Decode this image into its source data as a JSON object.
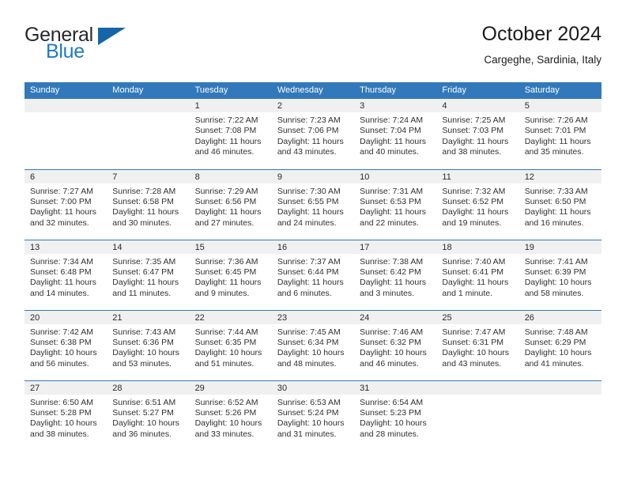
{
  "brand": {
    "name_part1": "General",
    "name_part2": "Blue",
    "flag_icon": "triangle-flag-icon",
    "accent_color": "#1e7bc4",
    "flag_color": "#1565a8"
  },
  "header": {
    "title": "October 2024",
    "subtitle": "Cargeghe, Sardinia, Italy"
  },
  "theme": {
    "header_bg": "#3279bb",
    "daynum_band_bg": "#f0f0f0",
    "row_separator": "#3279bb",
    "text": "#303030"
  },
  "weekday_headers": [
    "Sunday",
    "Monday",
    "Tuesday",
    "Wednesday",
    "Thursday",
    "Friday",
    "Saturday"
  ],
  "weeks": [
    [
      {
        "day": "",
        "sunrise": "",
        "sunset": "",
        "daylight_line1": "",
        "daylight_line2": "",
        "empty": true
      },
      {
        "day": "",
        "sunrise": "",
        "sunset": "",
        "daylight_line1": "",
        "daylight_line2": "",
        "empty": true
      },
      {
        "day": "1",
        "sunrise": "Sunrise: 7:22 AM",
        "sunset": "Sunset: 7:08 PM",
        "daylight_line1": "Daylight: 11 hours",
        "daylight_line2": "and 46 minutes."
      },
      {
        "day": "2",
        "sunrise": "Sunrise: 7:23 AM",
        "sunset": "Sunset: 7:06 PM",
        "daylight_line1": "Daylight: 11 hours",
        "daylight_line2": "and 43 minutes."
      },
      {
        "day": "3",
        "sunrise": "Sunrise: 7:24 AM",
        "sunset": "Sunset: 7:04 PM",
        "daylight_line1": "Daylight: 11 hours",
        "daylight_line2": "and 40 minutes."
      },
      {
        "day": "4",
        "sunrise": "Sunrise: 7:25 AM",
        "sunset": "Sunset: 7:03 PM",
        "daylight_line1": "Daylight: 11 hours",
        "daylight_line2": "and 38 minutes."
      },
      {
        "day": "5",
        "sunrise": "Sunrise: 7:26 AM",
        "sunset": "Sunset: 7:01 PM",
        "daylight_line1": "Daylight: 11 hours",
        "daylight_line2": "and 35 minutes."
      }
    ],
    [
      {
        "day": "6",
        "sunrise": "Sunrise: 7:27 AM",
        "sunset": "Sunset: 7:00 PM",
        "daylight_line1": "Daylight: 11 hours",
        "daylight_line2": "and 32 minutes."
      },
      {
        "day": "7",
        "sunrise": "Sunrise: 7:28 AM",
        "sunset": "Sunset: 6:58 PM",
        "daylight_line1": "Daylight: 11 hours",
        "daylight_line2": "and 30 minutes."
      },
      {
        "day": "8",
        "sunrise": "Sunrise: 7:29 AM",
        "sunset": "Sunset: 6:56 PM",
        "daylight_line1": "Daylight: 11 hours",
        "daylight_line2": "and 27 minutes."
      },
      {
        "day": "9",
        "sunrise": "Sunrise: 7:30 AM",
        "sunset": "Sunset: 6:55 PM",
        "daylight_line1": "Daylight: 11 hours",
        "daylight_line2": "and 24 minutes."
      },
      {
        "day": "10",
        "sunrise": "Sunrise: 7:31 AM",
        "sunset": "Sunset: 6:53 PM",
        "daylight_line1": "Daylight: 11 hours",
        "daylight_line2": "and 22 minutes."
      },
      {
        "day": "11",
        "sunrise": "Sunrise: 7:32 AM",
        "sunset": "Sunset: 6:52 PM",
        "daylight_line1": "Daylight: 11 hours",
        "daylight_line2": "and 19 minutes."
      },
      {
        "day": "12",
        "sunrise": "Sunrise: 7:33 AM",
        "sunset": "Sunset: 6:50 PM",
        "daylight_line1": "Daylight: 11 hours",
        "daylight_line2": "and 16 minutes."
      }
    ],
    [
      {
        "day": "13",
        "sunrise": "Sunrise: 7:34 AM",
        "sunset": "Sunset: 6:48 PM",
        "daylight_line1": "Daylight: 11 hours",
        "daylight_line2": "and 14 minutes."
      },
      {
        "day": "14",
        "sunrise": "Sunrise: 7:35 AM",
        "sunset": "Sunset: 6:47 PM",
        "daylight_line1": "Daylight: 11 hours",
        "daylight_line2": "and 11 minutes."
      },
      {
        "day": "15",
        "sunrise": "Sunrise: 7:36 AM",
        "sunset": "Sunset: 6:45 PM",
        "daylight_line1": "Daylight: 11 hours",
        "daylight_line2": "and 9 minutes."
      },
      {
        "day": "16",
        "sunrise": "Sunrise: 7:37 AM",
        "sunset": "Sunset: 6:44 PM",
        "daylight_line1": "Daylight: 11 hours",
        "daylight_line2": "and 6 minutes."
      },
      {
        "day": "17",
        "sunrise": "Sunrise: 7:38 AM",
        "sunset": "Sunset: 6:42 PM",
        "daylight_line1": "Daylight: 11 hours",
        "daylight_line2": "and 3 minutes."
      },
      {
        "day": "18",
        "sunrise": "Sunrise: 7:40 AM",
        "sunset": "Sunset: 6:41 PM",
        "daylight_line1": "Daylight: 11 hours",
        "daylight_line2": "and 1 minute."
      },
      {
        "day": "19",
        "sunrise": "Sunrise: 7:41 AM",
        "sunset": "Sunset: 6:39 PM",
        "daylight_line1": "Daylight: 10 hours",
        "daylight_line2": "and 58 minutes."
      }
    ],
    [
      {
        "day": "20",
        "sunrise": "Sunrise: 7:42 AM",
        "sunset": "Sunset: 6:38 PM",
        "daylight_line1": "Daylight: 10 hours",
        "daylight_line2": "and 56 minutes."
      },
      {
        "day": "21",
        "sunrise": "Sunrise: 7:43 AM",
        "sunset": "Sunset: 6:36 PM",
        "daylight_line1": "Daylight: 10 hours",
        "daylight_line2": "and 53 minutes."
      },
      {
        "day": "22",
        "sunrise": "Sunrise: 7:44 AM",
        "sunset": "Sunset: 6:35 PM",
        "daylight_line1": "Daylight: 10 hours",
        "daylight_line2": "and 51 minutes."
      },
      {
        "day": "23",
        "sunrise": "Sunrise: 7:45 AM",
        "sunset": "Sunset: 6:34 PM",
        "daylight_line1": "Daylight: 10 hours",
        "daylight_line2": "and 48 minutes."
      },
      {
        "day": "24",
        "sunrise": "Sunrise: 7:46 AM",
        "sunset": "Sunset: 6:32 PM",
        "daylight_line1": "Daylight: 10 hours",
        "daylight_line2": "and 46 minutes."
      },
      {
        "day": "25",
        "sunrise": "Sunrise: 7:47 AM",
        "sunset": "Sunset: 6:31 PM",
        "daylight_line1": "Daylight: 10 hours",
        "daylight_line2": "and 43 minutes."
      },
      {
        "day": "26",
        "sunrise": "Sunrise: 7:48 AM",
        "sunset": "Sunset: 6:29 PM",
        "daylight_line1": "Daylight: 10 hours",
        "daylight_line2": "and 41 minutes."
      }
    ],
    [
      {
        "day": "27",
        "sunrise": "Sunrise: 6:50 AM",
        "sunset": "Sunset: 5:28 PM",
        "daylight_line1": "Daylight: 10 hours",
        "daylight_line2": "and 38 minutes."
      },
      {
        "day": "28",
        "sunrise": "Sunrise: 6:51 AM",
        "sunset": "Sunset: 5:27 PM",
        "daylight_line1": "Daylight: 10 hours",
        "daylight_line2": "and 36 minutes."
      },
      {
        "day": "29",
        "sunrise": "Sunrise: 6:52 AM",
        "sunset": "Sunset: 5:26 PM",
        "daylight_line1": "Daylight: 10 hours",
        "daylight_line2": "and 33 minutes."
      },
      {
        "day": "30",
        "sunrise": "Sunrise: 6:53 AM",
        "sunset": "Sunset: 5:24 PM",
        "daylight_line1": "Daylight: 10 hours",
        "daylight_line2": "and 31 minutes."
      },
      {
        "day": "31",
        "sunrise": "Sunrise: 6:54 AM",
        "sunset": "Sunset: 5:23 PM",
        "daylight_line1": "Daylight: 10 hours",
        "daylight_line2": "and 28 minutes."
      },
      {
        "day": "",
        "sunrise": "",
        "sunset": "",
        "daylight_line1": "",
        "daylight_line2": "",
        "empty": true
      },
      {
        "day": "",
        "sunrise": "",
        "sunset": "",
        "daylight_line1": "",
        "daylight_line2": "",
        "empty": true
      }
    ]
  ]
}
